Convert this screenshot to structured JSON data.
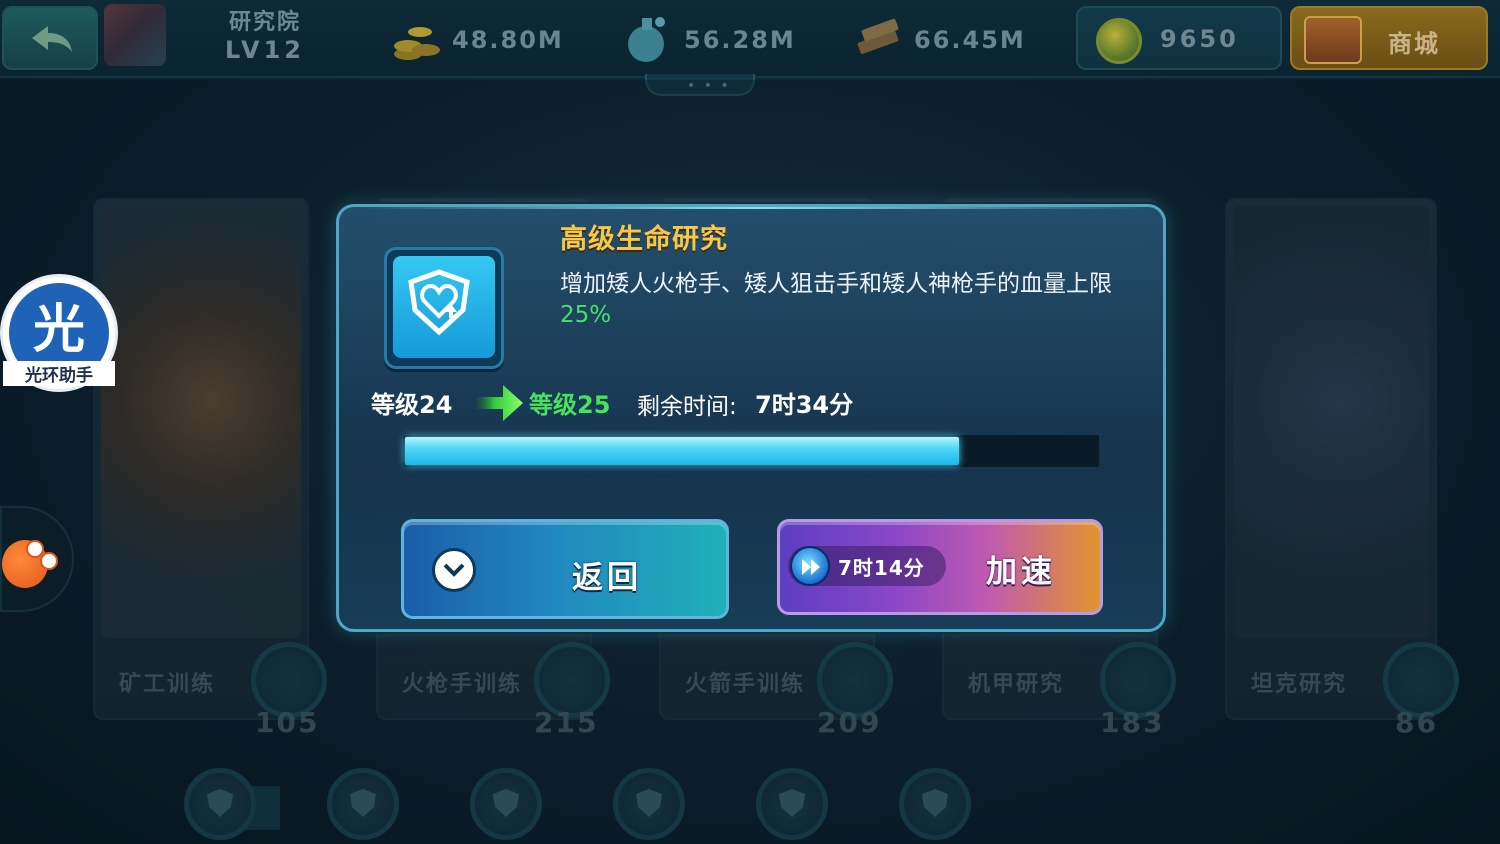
{
  "topbar": {
    "building_title": "研究院",
    "building_level": "LV12",
    "resources": [
      {
        "icon": "gold-coins-icon",
        "value": "48.80M"
      },
      {
        "icon": "potion-flask-icon",
        "value": "56.28M"
      },
      {
        "icon": "wood-planks-icon",
        "value": "66.45M"
      }
    ],
    "gems": "9650",
    "shop_label": "商城"
  },
  "background_cards": [
    {
      "name": "矿工训练",
      "count": "105",
      "icon": "pickaxe-icon"
    },
    {
      "name": "火枪手训练",
      "count": "215",
      "icon": "musket-icon"
    },
    {
      "name": "火箭手训练",
      "count": "209",
      "icon": "rocket-icon"
    },
    {
      "name": "机甲研究",
      "count": "183",
      "icon": "gear-icon"
    },
    {
      "name": "坦克研究",
      "count": "86",
      "icon": "tank-icon"
    }
  ],
  "side": {
    "halo_char": "光",
    "halo_text": "光环助手"
  },
  "dialog": {
    "title": "高级生命研究",
    "description": "增加矮人火枪手、矮人狙击手和矮人神枪手的血量上限",
    "percent": "25%",
    "level_from": "等级24",
    "level_to": "等级25",
    "remaining_label": "剩余时间:",
    "remaining_value": "7时34分",
    "progress": 0.8,
    "back_label": "返回",
    "speedup_time": "7时14分",
    "speedup_label": "加速"
  },
  "colors": {
    "title_gold": "#f6c84a",
    "level_green": "#46e35c",
    "progress_cyan": "#4fd8f8"
  }
}
